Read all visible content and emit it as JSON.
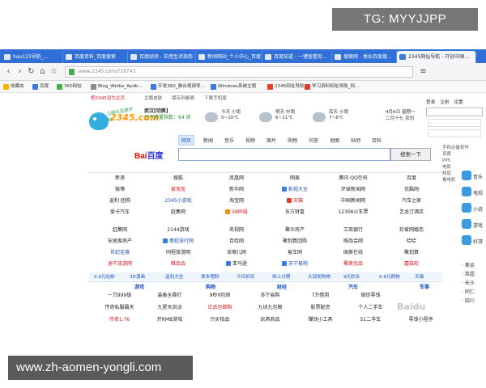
{
  "watermarks": {
    "top_right": "TG: MYYJJPP",
    "bottom_left": "www.zh-aomen-yongli.com",
    "overlay": "Baidu"
  },
  "browser": {
    "tabs": [
      {
        "label": "hao123导航_…"
      },
      {
        "label": "百度百科_百度搜索"
      },
      {
        "label": "百度经验 - 实用生活指南"
      },
      {
        "label": "新闻网站_个人中心_百度"
      },
      {
        "label": "百度知道 - 一键查看你…"
      },
      {
        "label": "搜索网 - 类似百度搜…"
      },
      {
        "label": "2345网址导航 - 开创中国…"
      }
    ],
    "url": "www.2345.com/?28743",
    "bookmarks": [
      {
        "label": "收藏夹",
        "color": "#f4b400"
      },
      {
        "label": "百度",
        "color": "#3a7be0"
      },
      {
        "label": "360网址",
        "color": "#46b04a"
      },
      {
        "label": "Blog_Weibo_Apdb…",
        "color": "#8a8a8a"
      },
      {
        "label": "开发360_聚合视频导…",
        "color": "#3a7be0"
      },
      {
        "label": "Windows系统主题",
        "color": "#3a7be0"
      },
      {
        "label": "2345网址导航",
        "color": "#e43d2c"
      },
      {
        "label": "学习资料网址导航_网…",
        "color": "#e43d2c"
      }
    ]
  },
  "page": {
    "subbar": {
      "set_home": "把2345设为主页",
      "theme": "主题皮肤",
      "history": "保存到桌面",
      "mobile": "下载手机版"
    },
    "logo": {
      "brand": "2345.com",
      "slogan": "上网从这里开始"
    },
    "city": {
      "name": "武汉[切换]",
      "aqi": "空气质量指数：64 良"
    },
    "weather": [
      {
        "day": "今天 小雨",
        "temp": "5~10℃"
      },
      {
        "day": "明天 中雨",
        "temp": "6~11℃"
      },
      {
        "day": "后天 小雨",
        "temp": "7~8℃"
      }
    ],
    "date": {
      "line1": "4月6日 星期一",
      "line2": "二月十七 农历"
    },
    "rightlinks": [
      "登录",
      "注册",
      "设置"
    ],
    "search": {
      "tabs": [
        "网页",
        "新闻",
        "音乐",
        "视频",
        "图片",
        "购物",
        "问答",
        "地图",
        "贴吧",
        "百科"
      ],
      "active_index": 0,
      "engine": "百度",
      "button": "搜索一下",
      "tips": [
        "手机必备软件",
        "百度",
        "PPS",
        "电影",
        "知道",
        "看电影"
      ]
    },
    "grid": [
      [
        "新浪",
        "搜狐",
        "凤凰网",
        "网易",
        "腾讯·QQ空间",
        "百度"
      ],
      [
        "微博",
        "爱淘宝",
        "新华网",
        "影视大全",
        "环球新闻网",
        "优酷网"
      ],
      [
        "返利·团购",
        "2345小游戏",
        "淘宝网",
        "天猫",
        "中国新闻网",
        "汽车之家"
      ],
      [
        "爱卡汽车",
        "赶集网",
        "58同城",
        "东方财富",
        "12306火车票",
        "艺龙订酒店"
      ],
      [
        "赶集网",
        "2144游戏",
        "央视网",
        "聚众房产",
        "工商银行",
        "珍爱网婚恋"
      ],
      [
        "安居客房产",
        "携程旅行网",
        "百姓网",
        "聚划算团购",
        "唯品会网",
        "哈哈"
      ],
      [
        "世纪佳缘",
        "同程旅游网",
        "去哪儿网",
        "易车网",
        "国美在线",
        "聚划算"
      ],
      [
        "途牛旅游网",
        "唯品会",
        "亚马逊",
        "苏宁易购",
        "聚美优品",
        "蘑菇街"
      ]
    ],
    "bottomstrip": [
      "0.9元包邮",
      "3D漫画",
      "返利大全",
      "保本理财",
      "今日折扣",
      "线上分期",
      "大润发购物",
      "9元秒杀",
      "0.8元购物",
      "天猫"
    ],
    "categories": [
      "游戏",
      "购物",
      "财经",
      "汽车",
      "军事"
    ],
    "lists": [
      [
        "一刀999级",
        "装备全靠打",
        "9秒9包邮",
        "苏宁易购",
        "7万借用",
        "微信零钱"
      ],
      [
        "传奇私服霸天",
        "九星天剑诀",
        "正品包邮购",
        "九块九包邮",
        "股票配资",
        "个人二手车"
      ],
      [
        "传奇1.76",
        "开RMB游戏",
        "只买拍品",
        "玩具商品",
        "赚钱小工具",
        "51二手车",
        "零钱小程序"
      ]
    ],
    "side": {
      "items": [
        "音乐",
        "电视",
        "小说",
        "游戏",
        "好游"
      ],
      "list": [
        "奥运",
        "英超",
        "长沙",
        "同仁",
        "四川"
      ]
    }
  }
}
